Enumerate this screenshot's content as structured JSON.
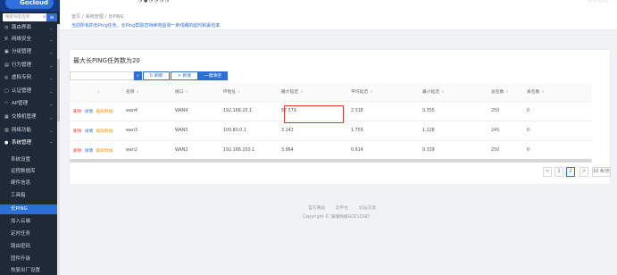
{
  "brand": {
    "logo_text": "Gocloud"
  },
  "sidebar": {
    "search_placeholder": "搜索导航选项",
    "items": [
      {
        "label": "路由界面",
        "icon": "sandglass-icon"
      },
      {
        "label": "网络安全",
        "icon": "shield-icon"
      },
      {
        "label": "分组管理",
        "icon": "group-icon"
      },
      {
        "label": "行为管理",
        "icon": "behavior-icon"
      },
      {
        "label": "虚拟专网",
        "icon": "vpn-icon"
      },
      {
        "label": "认证管理",
        "icon": "auth-icon"
      },
      {
        "label": "AP管理",
        "icon": "wifi-icon"
      },
      {
        "label": "交换机管理",
        "icon": "switch-icon"
      },
      {
        "label": "网络功能",
        "icon": "network-icon"
      },
      {
        "label": "系统管理",
        "icon": "system-icon"
      }
    ],
    "sub_items": [
      {
        "label": "系统设置"
      },
      {
        "label": "远程数据库"
      },
      {
        "label": "硬件信息"
      },
      {
        "label": "工具箱"
      },
      {
        "label": "长PING"
      },
      {
        "label": "加入云端"
      },
      {
        "label": "定时任务"
      },
      {
        "label": "路由密码"
      },
      {
        "label": "固件升级"
      },
      {
        "label": "恢复出厂设置"
      }
    ]
  },
  "header": {
    "breadcrumb": [
      "首页",
      "系统管理",
      "长PING"
    ],
    "description": "当前所有的长Ping任务。长Ping帮助您持续地监测一条线路的延时和丢包率"
  },
  "card": {
    "title": "最大长PING任务数为20",
    "search_value": "",
    "refresh_label": "刷新",
    "add_label": "+ 新增",
    "clear_label": "一键清空"
  },
  "table": {
    "columns": [
      "",
      "名称",
      "接口",
      "IP地址",
      "最大延迟",
      "平均延迟",
      "最小延迟",
      "总包数",
      "丢包数"
    ],
    "op_labels": {
      "delete": "删除",
      "detail": "详情",
      "edit": "编辑数据"
    },
    "rows": [
      {
        "name": "wan4",
        "interface": "WAN4",
        "ip": "192.168.20.1",
        "max": "87.579",
        "avg": "2.318",
        "min": "0.355",
        "total": "250",
        "lost": "0"
      },
      {
        "name": "wan3",
        "interface": "WAN3",
        "ip": "100.80.0.1",
        "max": "3.243",
        "avg": "1.759",
        "min": "1.228",
        "total": "245",
        "lost": "0"
      },
      {
        "name": "wan2",
        "interface": "WAN2",
        "ip": "192.168.200.1",
        "max": "3.964",
        "avg": "0.614",
        "min": "0.339",
        "total": "250",
        "lost": "0"
      }
    ]
  },
  "pager": {
    "prev": "<",
    "page1": "1",
    "current": "2",
    "next": ">",
    "size": "10 条/页"
  },
  "footer": {
    "links": [
      "官方网站",
      "云平台",
      "论坛交流"
    ],
    "copyright": "Copyright © 蒲瑞网络GOCLOUD"
  },
  "colors": {
    "primary": "#2b6fd7",
    "sidebar_bg": "#1f2937",
    "highlight": "#e0332c"
  }
}
